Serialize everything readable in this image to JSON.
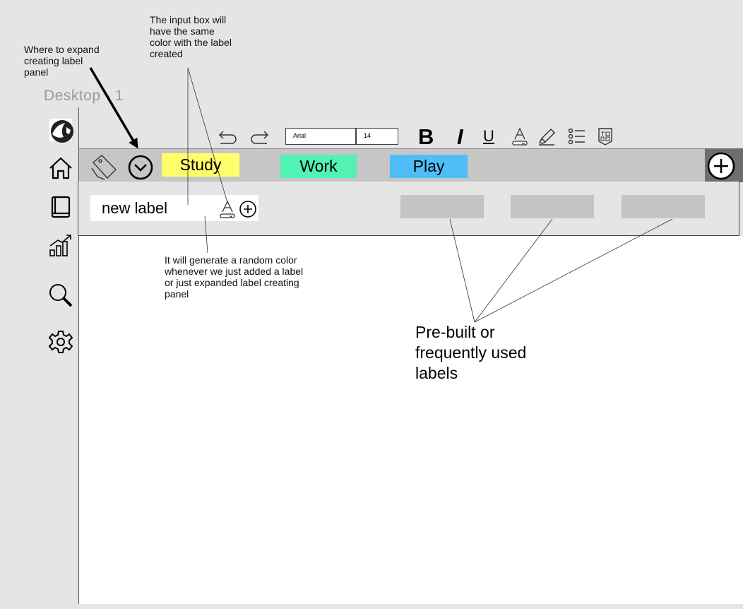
{
  "annotations": {
    "expand_panel": [
      "Where to expand",
      "creating label",
      "panel"
    ],
    "input_color": [
      "The input box will",
      "have the same",
      "color with the label",
      "created"
    ],
    "random_color": [
      "It will generate a random color",
      "whenever we just added a label",
      "or just expanded label creating",
      "panel"
    ],
    "prebuilt": [
      "Pre-built or",
      "frequently used",
      "labels"
    ]
  },
  "frame": {
    "title": "Desktop - 1"
  },
  "sidebar": {
    "icons": [
      "globe-logo-icon",
      "home-icon",
      "book-icon",
      "chart-growth-icon",
      "search-icon",
      "gear-icon"
    ]
  },
  "toolbar": {
    "font_family": "Arial",
    "font_size": "14",
    "bold": "B",
    "italic": "I",
    "underline": "U"
  },
  "labels": [
    {
      "name": "Study",
      "color": "#ffff6b"
    },
    {
      "name": "Work",
      "color": "#52f2b4"
    },
    {
      "name": "Play",
      "color": "#4fbef7"
    }
  ],
  "create_panel": {
    "input_value": "new label",
    "prebuilt_count": 3
  },
  "colors": {
    "frame_bg": "#e5e5e5",
    "label_bar": "#c6c6c6",
    "add_area": "#6e6e6e",
    "prebuilt": "#c4c4c4"
  }
}
